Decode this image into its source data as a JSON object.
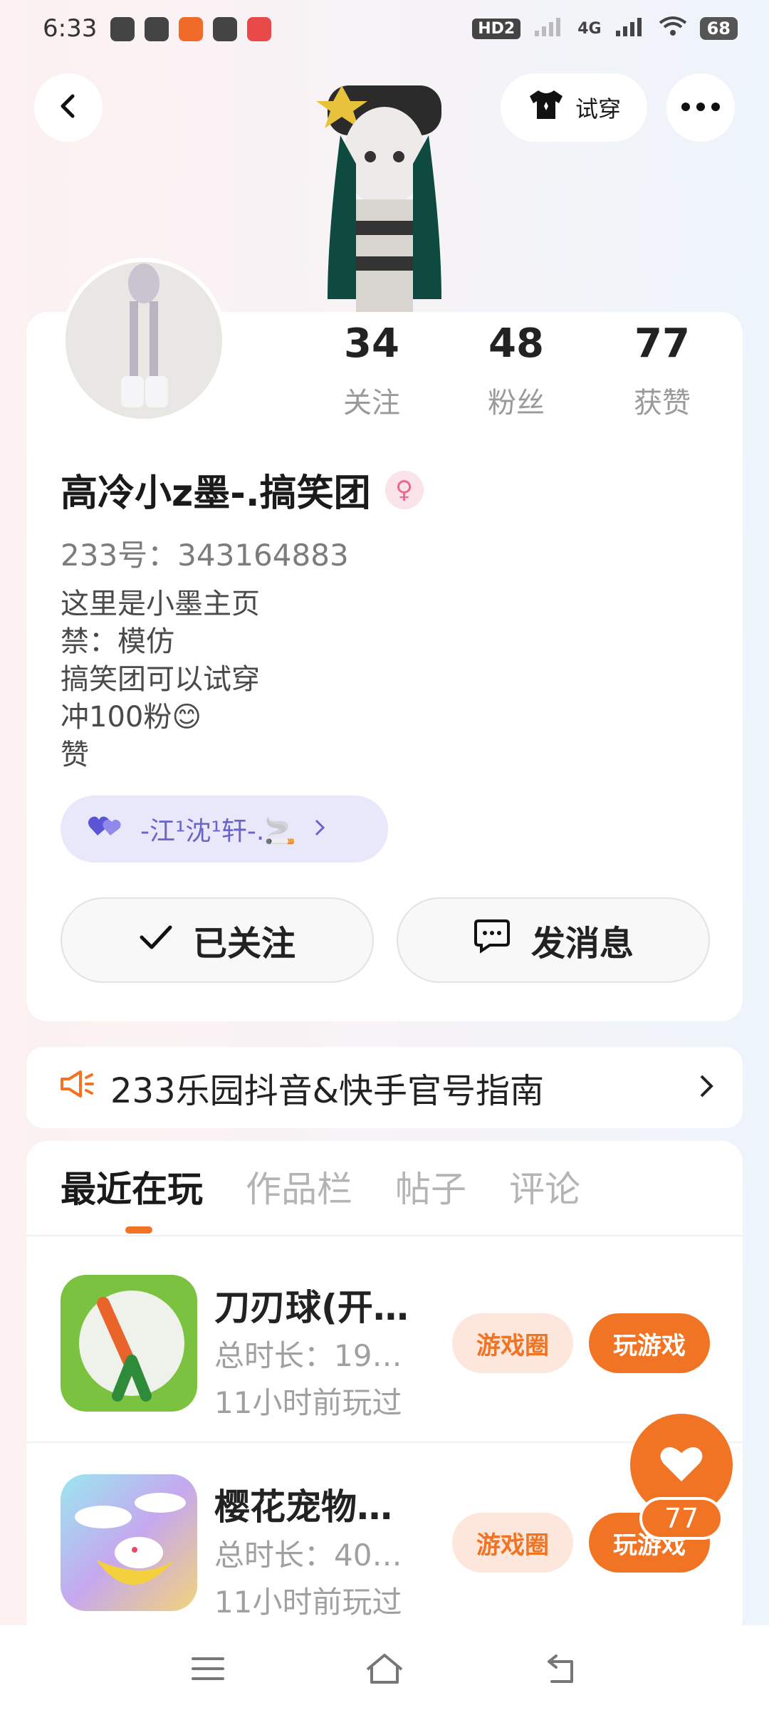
{
  "status_bar": {
    "time": "6:33",
    "network": "4G",
    "hd": "HD2",
    "battery": "68"
  },
  "header": {
    "try_on_label": "试穿"
  },
  "stats": [
    {
      "count": "34",
      "label": "关注"
    },
    {
      "count": "48",
      "label": "粉丝"
    },
    {
      "count": "77",
      "label": "获赞"
    }
  ],
  "profile": {
    "name": "高冷小z墨-.搞笑团",
    "uid": "233号：343164883",
    "bio": [
      "这里是小墨主页",
      "禁：模仿",
      "搞笑团可以试穿",
      "冲100粉😊",
      "赞"
    ],
    "relation_name": "-江¹沈¹轩-.🚬",
    "follow_label": "已关注",
    "message_label": "发消息"
  },
  "guide": {
    "text": "233乐园抖音&快手官号指南"
  },
  "tabs": [
    "最近在玩",
    "作品栏",
    "帖子",
    "评论"
  ],
  "games": [
    {
      "title": "刀刃球(开…",
      "duration": "总时长：19…",
      "last_played": "11小时前玩过",
      "circle_label": "游戏圈",
      "play_label": "玩游戏"
    },
    {
      "title": "樱花宠物…",
      "duration": "总时长：40…",
      "last_played": "11小时前玩过",
      "circle_label": "游戏圈",
      "play_label": "玩游戏"
    }
  ],
  "like_fab": {
    "count": "77"
  },
  "colors": {
    "accent": "#f07423",
    "accent_light": "#fde7dc",
    "relation_bg": "#e9e8fb"
  }
}
